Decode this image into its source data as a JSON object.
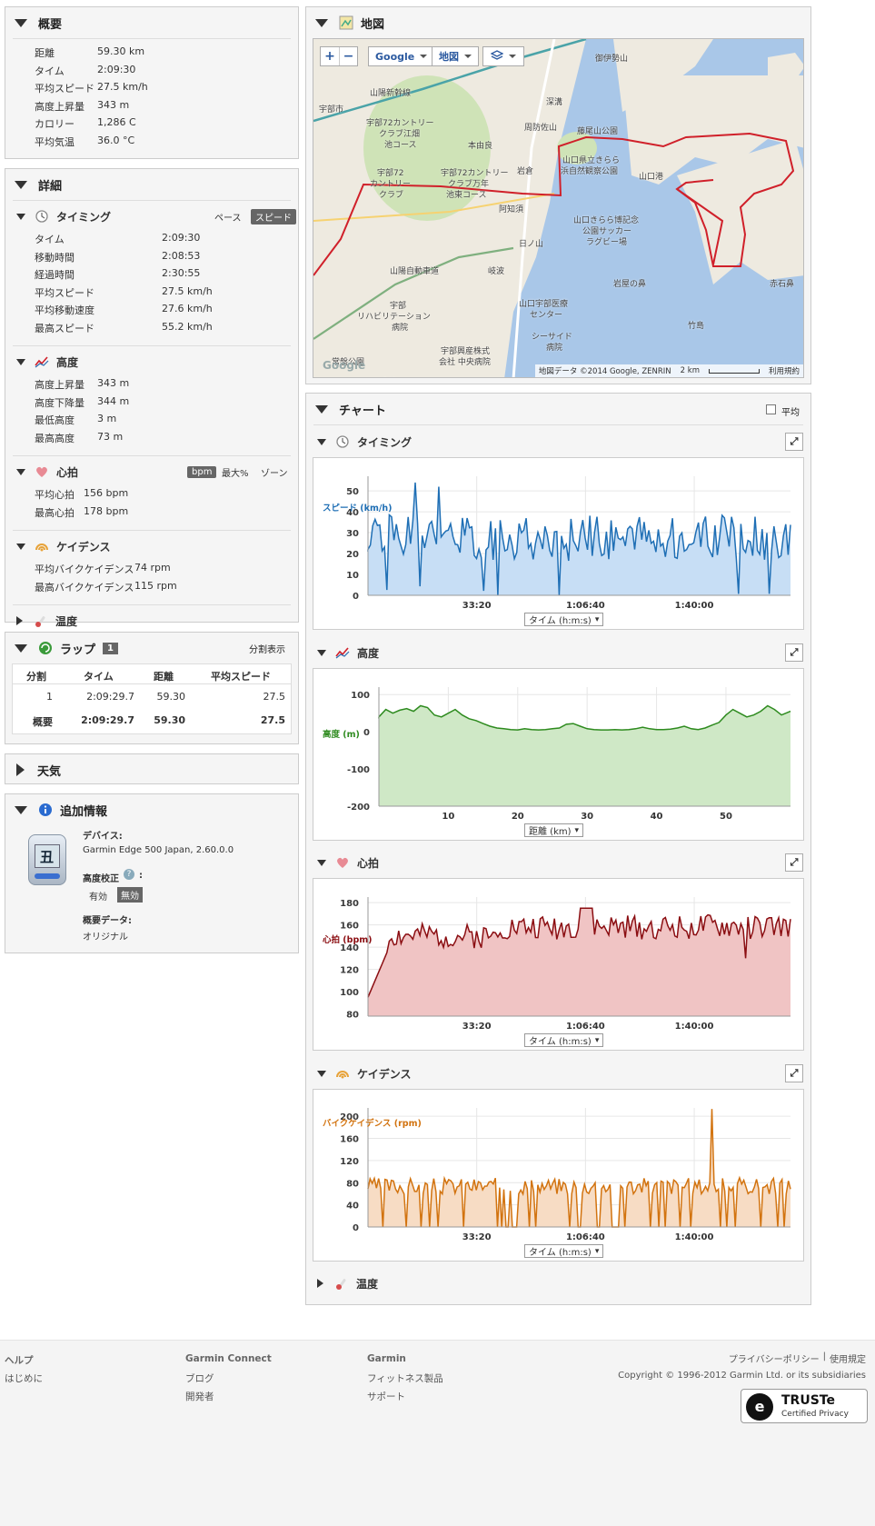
{
  "summary": {
    "title": "概要",
    "rows": [
      {
        "k": "距離",
        "v": "59.30 km"
      },
      {
        "k": "タイム",
        "v": "2:09:30"
      },
      {
        "k": "平均スピード",
        "v": "27.5 km/h"
      },
      {
        "k": "高度上昇量",
        "v": "343 m"
      },
      {
        "k": "カロリー",
        "v": "1,286 C"
      },
      {
        "k": "平均気温",
        "v": "36.0 °C"
      }
    ]
  },
  "details": {
    "title": "詳細",
    "timing": {
      "title": "タイミング",
      "pace": "ペース",
      "speed": "スピード",
      "rows": [
        {
          "k": "タイム",
          "v": "2:09:30"
        },
        {
          "k": "移動時間",
          "v": "2:08:53"
        },
        {
          "k": "経過時間",
          "v": "2:30:55"
        },
        {
          "k": "平均スピード",
          "v": "27.5 km/h"
        },
        {
          "k": "平均移動速度",
          "v": "27.6 km/h"
        },
        {
          "k": "最高スピード",
          "v": "55.2 km/h"
        }
      ]
    },
    "elevation": {
      "title": "高度",
      "rows": [
        {
          "k": "高度上昇量",
          "v": "343 m"
        },
        {
          "k": "高度下降量",
          "v": "344 m"
        },
        {
          "k": "最低高度",
          "v": "3 m"
        },
        {
          "k": "最高高度",
          "v": "73 m"
        }
      ]
    },
    "hr": {
      "title": "心拍",
      "bpm": "bpm",
      "max": "最大%",
      "zone": "ゾーン",
      "rows": [
        {
          "k": "平均心拍",
          "v": "156 bpm"
        },
        {
          "k": "最高心拍",
          "v": "178 bpm"
        }
      ]
    },
    "cadence": {
      "title": "ケイデンス",
      "rows": [
        {
          "k": "平均バイクケイデンス",
          "v": "74 rpm"
        },
        {
          "k": "最高バイクケイデンス",
          "v": "115 rpm"
        }
      ]
    },
    "temp": {
      "title": "温度"
    }
  },
  "laps": {
    "title": "ラップ",
    "count": "1",
    "split_view": "分割表示",
    "headers": [
      "分割",
      "タイム",
      "距離",
      "平均スピード"
    ],
    "row": [
      "1",
      "2:09:29.7",
      "59.30",
      "27.5"
    ],
    "summary": [
      "概要",
      "2:09:29.7",
      "59.30",
      "27.5"
    ]
  },
  "weather": {
    "title": "天気"
  },
  "info": {
    "title": "追加情報",
    "device_label": "デバイス:",
    "device": "Garmin Edge 500 Japan, 2.60.0.0",
    "elev_corr": "高度校正",
    "on": "有効",
    "off": "無効",
    "summary_data": "概要データ:",
    "original": "オリジナル",
    "device_screen": "丑"
  },
  "map": {
    "title": "地図",
    "plus": "+",
    "minus": "−",
    "google": "Google",
    "maptype": "地図",
    "copyright": "地図データ ©2014 Google, ZENRIN",
    "scale": "2 km",
    "terms": "利用規約",
    "google_logo": "Google",
    "labels": [
      {
        "t": "宇部市",
        "x": 6,
        "y": 70
      },
      {
        "t": "山陽新幹線",
        "x": 62,
        "y": 52
      },
      {
        "t": "宇部72カントリー",
        "x": 58,
        "y": 85
      },
      {
        "t": "クラブ江畑",
        "x": 72,
        "y": 97
      },
      {
        "t": "池コース",
        "x": 78,
        "y": 109
      },
      {
        "t": "宇部72",
        "x": 70,
        "y": 140
      },
      {
        "t": "カントリー",
        "x": 62,
        "y": 152
      },
      {
        "t": "クラブ",
        "x": 72,
        "y": 164
      },
      {
        "t": "宇部72カントリー",
        "x": 140,
        "y": 140
      },
      {
        "t": "クラブ万年",
        "x": 148,
        "y": 152
      },
      {
        "t": "池東コース",
        "x": 146,
        "y": 164
      },
      {
        "t": "本由良",
        "x": 170,
        "y": 110
      },
      {
        "t": "岩倉",
        "x": 224,
        "y": 138
      },
      {
        "t": "阿知須",
        "x": 204,
        "y": 180
      },
      {
        "t": "日ノ山",
        "x": 226,
        "y": 218
      },
      {
        "t": "岐波",
        "x": 192,
        "y": 248
      },
      {
        "t": "山陽自動車道",
        "x": 84,
        "y": 248
      },
      {
        "t": "宇部",
        "x": 84,
        "y": 286
      },
      {
        "t": "リハビリテーション",
        "x": 48,
        "y": 298
      },
      {
        "t": "病院",
        "x": 86,
        "y": 310
      },
      {
        "t": "常盤公園",
        "x": 20,
        "y": 348
      },
      {
        "t": "宇部興産株式",
        "x": 140,
        "y": 336
      },
      {
        "t": "会社 中央病院",
        "x": 138,
        "y": 348
      },
      {
        "t": "床波",
        "x": 74,
        "y": 370
      },
      {
        "t": "深溝",
        "x": 256,
        "y": 62
      },
      {
        "t": "周防佐山",
        "x": 232,
        "y": 90
      },
      {
        "t": "藤尾山公園",
        "x": 290,
        "y": 94
      },
      {
        "t": "山口県立きらら",
        "x": 274,
        "y": 126
      },
      {
        "t": "浜自然観察公園",
        "x": 272,
        "y": 138
      },
      {
        "t": "山口港",
        "x": 358,
        "y": 144
      },
      {
        "t": "山口きらら博記念",
        "x": 286,
        "y": 192
      },
      {
        "t": "公園サッカー",
        "x": 296,
        "y": 204
      },
      {
        "t": "ラグビー場",
        "x": 300,
        "y": 216
      },
      {
        "t": "岩屋の鼻",
        "x": 330,
        "y": 262
      },
      {
        "t": "山口宇部医療",
        "x": 226,
        "y": 284
      },
      {
        "t": "センター",
        "x": 238,
        "y": 296
      },
      {
        "t": "シーサイド",
        "x": 240,
        "y": 320
      },
      {
        "t": "病院",
        "x": 256,
        "y": 332
      },
      {
        "t": "竹島",
        "x": 412,
        "y": 308
      },
      {
        "t": "赤石鼻",
        "x": 502,
        "y": 262
      },
      {
        "t": "御伊勢山",
        "x": 310,
        "y": 14
      }
    ]
  },
  "charts": {
    "title": "チャート",
    "avg": "平均",
    "timing": {
      "title": "タイミング",
      "select": "タイム (h:m:s)"
    },
    "elevation": {
      "title": "高度",
      "select": "距離 (km)"
    },
    "hr": {
      "title": "心拍",
      "select": "タイム (h:m:s)"
    },
    "cadence": {
      "title": "ケイデンス",
      "select": "タイム (h:m:s)"
    },
    "temp": {
      "title": "温度"
    }
  },
  "chart_data": [
    {
      "type": "area",
      "ylabel": "スピード (km/h)",
      "yticks": [
        0,
        10,
        20,
        30,
        40,
        50
      ],
      "xticks": [
        "33:20",
        "1:06:40",
        "1:40:00"
      ],
      "xtick_seconds": [
        2000,
        4000,
        6000
      ],
      "ylim": [
        0,
        57
      ],
      "xlim": [
        0,
        7770
      ],
      "color": "#1f6fb5",
      "fill": "#c7def5",
      "n_points": 180,
      "mean": 27.5
    },
    {
      "type": "area",
      "ylabel": "高度 (m)",
      "yticks": [
        100,
        0,
        -100,
        -200
      ],
      "xticks": [
        10,
        20,
        30,
        40,
        50
      ],
      "ylim": [
        -200,
        120
      ],
      "xlim": [
        0,
        59.3
      ],
      "color": "#2e8b1f",
      "fill": "#cfe8c6",
      "x": [
        0,
        1,
        2,
        3,
        4,
        5,
        6,
        7,
        8,
        9,
        10,
        11,
        12,
        13,
        14,
        15,
        16,
        17,
        18,
        19,
        20,
        21,
        22,
        23,
        24,
        25,
        26,
        27,
        28,
        29,
        30,
        31,
        32,
        33,
        34,
        35,
        36,
        37,
        38,
        39,
        40,
        41,
        42,
        43,
        44,
        45,
        46,
        47,
        48,
        49,
        50,
        51,
        52,
        53,
        54,
        55,
        56,
        57,
        58,
        59.3
      ],
      "y": [
        40,
        60,
        50,
        58,
        62,
        55,
        70,
        65,
        45,
        40,
        50,
        60,
        45,
        35,
        30,
        22,
        15,
        10,
        8,
        6,
        5,
        8,
        6,
        5,
        6,
        8,
        10,
        20,
        22,
        15,
        8,
        6,
        5,
        5,
        6,
        5,
        6,
        8,
        12,
        8,
        6,
        6,
        7,
        10,
        15,
        8,
        6,
        10,
        18,
        25,
        45,
        60,
        50,
        40,
        45,
        55,
        70,
        60,
        45,
        55
      ]
    },
    {
      "type": "area",
      "ylabel": "心拍 (bpm)",
      "yticks": [
        80,
        100,
        120,
        140,
        160,
        180
      ],
      "xticks": [
        "33:20",
        "1:06:40",
        "1:40:00"
      ],
      "xtick_seconds": [
        2000,
        4000,
        6000
      ],
      "ylim": [
        78,
        185
      ],
      "xlim": [
        0,
        7770
      ],
      "color": "#8b0e12",
      "fill": "#f0c4c4",
      "n_points": 180,
      "mean": 156
    },
    {
      "type": "area",
      "ylabel": "バイクケイデンス (rpm)",
      "yticks": [
        0,
        40,
        80,
        120,
        160,
        200
      ],
      "xticks": [
        "33:20",
        "1:06:40",
        "1:40:00"
      ],
      "xtick_seconds": [
        2000,
        4000,
        6000
      ],
      "ylim": [
        0,
        215
      ],
      "xlim": [
        0,
        7770
      ],
      "color": "#d2730f",
      "fill": "#f7dcc4",
      "n_points": 200,
      "mean": 74
    }
  ],
  "footer": {
    "help": "ヘルプ",
    "start": "はじめに",
    "gc": "Garmin Connect",
    "blog": "ブログ",
    "dev": "開発者",
    "garmin": "Garmin",
    "fitness": "フィットネス製品",
    "support": "サポート",
    "privacy": "プライバシーポリシー",
    "sep": "|",
    "terms": "使用規定",
    "copy": "Copyright © 1996-2012 Garmin Ltd. or its subsidiaries",
    "truste": "TRUSTe",
    "certified": "Certified Privacy"
  },
  "colors": {
    "accent": "#1f6fb5",
    "route": "#d0202a",
    "sea": "#a9c7e8",
    "land": "#eeeae0",
    "park": "#cfe3b7"
  }
}
